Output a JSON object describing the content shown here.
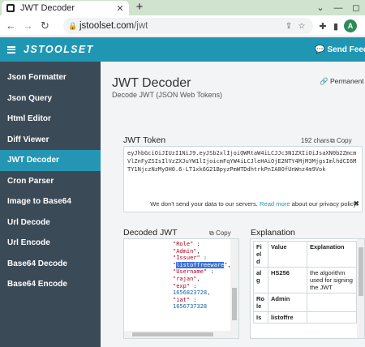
{
  "browser": {
    "tab_title": "JWT Decoder",
    "tab_close": "✕",
    "new_tab": "+",
    "window_controls": [
      "⌄",
      "—",
      "◻"
    ],
    "url_domain": "jstoolset.com",
    "url_path": "/jwt",
    "avatar_initial": "A",
    "back": "←",
    "forward": "→",
    "reload": "↻",
    "home": "⌂",
    "lock": "🔒",
    "share": "⇪",
    "star": "☆",
    "puzzle": "✚",
    "panel": "▮",
    "toolbar_icons": [
      "puzzle-icon",
      "side-panel-icon"
    ]
  },
  "site": {
    "logo": "JSTOOLSET",
    "send_feedback": "Send Feedb",
    "chat_icon": "💬"
  },
  "sidebar": {
    "items": [
      {
        "label": "Json Formatter",
        "active": false
      },
      {
        "label": "Json Query",
        "active": false
      },
      {
        "label": "Html Editor",
        "active": false
      },
      {
        "label": "Diff Viewer",
        "active": false
      },
      {
        "label": "JWT Decoder",
        "active": true
      },
      {
        "label": "Cron Parser",
        "active": false
      },
      {
        "label": "Image to Base64",
        "active": false
      },
      {
        "label": "Url Decode",
        "active": false
      },
      {
        "label": "Url Encode",
        "active": false
      },
      {
        "label": "Base64 Decode",
        "active": false
      },
      {
        "label": "Base64 Encode",
        "active": false
      }
    ]
  },
  "main": {
    "title": "JWT Decoder",
    "subtitle": "Decode JWT (JSON Web Tokens)",
    "permalink": "Permanent L",
    "link_icon": "🔗"
  },
  "jwt_token": {
    "label": "JWT Token",
    "chars": "192 chars",
    "copy": "Copy",
    "copy_icon": "⧉",
    "value": "eyJhbGciOiJIUzI1NiJ9.eyJSb2xlIjoiQWRtaW4iLCJJc3N1ZXIiOiJsaXN0b2ZmcmVlZnFyZSIsIlVzZXJuYW1lIjoicmFqYW4iLCJleHAiOjE2NTY4MjM3MjgsImlhdCI6MTY1NjczNzMyOH0.6-LT1xk6G21BpyzPmWTDdhtrkPnIA8OfUnWnz4m9Vok",
    "notice_pre": "We don't send your data to our servers. ",
    "notice_link": "Read more",
    "notice_post": " about our privacy policy.",
    "dismiss": "✖"
  },
  "decoded": {
    "label": "Decoded JWT",
    "copy": "Copy",
    "copy_icon": "⧉",
    "lines": {
      "role_key": "\"Role\"",
      "role_val": "\"Admin\"",
      "issuer_key": "\"Issuer\"",
      "issuer_q": "\"",
      "issuer_val": "listoffreeware",
      "issuer_q2": "\"",
      "user_key": "\"Username\"",
      "user_val": "\"rajan\"",
      "exp_key": "\"exp\"",
      "exp_val": "1656823728",
      "iat_key": "\"iat\"",
      "iat_val": "1656737328",
      "sep": " :",
      "comma": ","
    }
  },
  "explanation": {
    "label": "Explanation",
    "headers": [
      "Fi\nel\nd",
      "Value",
      "Explanation"
    ],
    "rows": [
      {
        "field": "al\ng",
        "value": "HS256",
        "expl": "the algorithm used for signing the JWT"
      },
      {
        "field": "Ro\nle",
        "value": "Admin",
        "expl": ""
      },
      {
        "field": "Is",
        "value": "listoffre",
        "expl": ""
      }
    ]
  }
}
